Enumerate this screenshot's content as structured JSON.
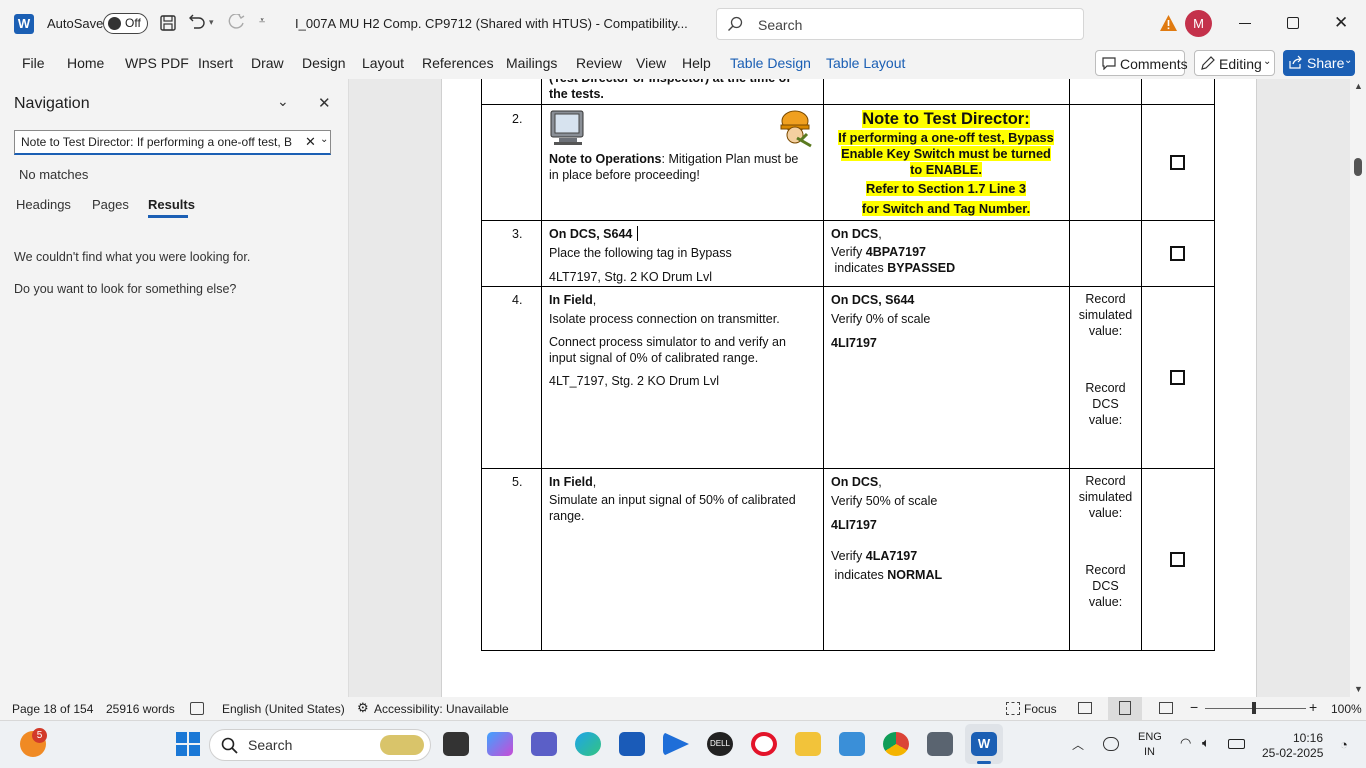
{
  "titlebar": {
    "autosave_label": "AutoSave",
    "autosave_state": "Off",
    "doc_title": "I_007A MU H2 Comp. CP9712 (Shared with HTUS)  -  Compatibility...",
    "search_placeholder": "Search",
    "avatar_initial": "M"
  },
  "ribbon": {
    "tabs": [
      "File",
      "Home",
      "WPS PDF",
      "Insert",
      "Draw",
      "Design",
      "Layout",
      "References",
      "Mailings",
      "Review",
      "View",
      "Help",
      "Table Design",
      "Table Layout"
    ],
    "comments_label": "Comments",
    "editing_label": "Editing",
    "share_label": "Share"
  },
  "navigation": {
    "title": "Navigation",
    "search_value": "Note to Test Director: If performing a one-off test, B",
    "no_matches": "No matches",
    "tabs": [
      "Headings",
      "Pages",
      "Results"
    ],
    "active_tab": "Results",
    "message1": "We couldn't find what you were looking for.",
    "message2": "Do you want to look for something else?"
  },
  "document": {
    "top_fragment_line1": "(Test Director or Inspector) at the time of",
    "top_fragment_line2": "the tests.",
    "row2": {
      "num": "2.",
      "note_label": "Note to Operations",
      "note_text1": ": Mitigation Plan must be",
      "note_text2": "in place before proceeding!",
      "td_title": "Note to Test Director:",
      "td_line1": "If performing a one-off test, Bypass",
      "td_line2": "Enable Key Switch must be turned",
      "td_line3": "to ENABLE.",
      "td_line4": "Refer to Section 1.7 Line 3",
      "td_line5": "for Switch and Tag Number."
    },
    "row3": {
      "num": "3.",
      "action_line1": "On DCS, S644",
      "action_line2": "Place the following tag in Bypass",
      "action_line3": "4LT7197, Stg. 2 KO Drum Lvl",
      "verify_line1": "On DCS",
      "verify_comma": ",",
      "verify_prefix": "Verify ",
      "verify_tag": "4BPA7197",
      "indicates_prefix": " indicates ",
      "indicates_value": "BYPASSED"
    },
    "row4": {
      "num": "4.",
      "field_label": "In Field",
      "field_comma": ",",
      "action_line2": "Isolate process connection on transmitter.",
      "action_line3": "Connect process simulator to and verify an",
      "action_line4": "input signal of 0% of calibrated range.",
      "action_line5": "4LT_7197, Stg. 2 KO Drum Lvl",
      "verify_line1": "On DCS, S644",
      "verify_line2": "Verify 0% of scale",
      "verify_line3": "4LI7197",
      "record1": [
        "Record",
        "simulated",
        "value:"
      ],
      "record2": [
        "Record",
        "DCS",
        "value:"
      ]
    },
    "row5": {
      "num": "5.",
      "field_label": "In Field",
      "field_comma": ",",
      "action_line2": "Simulate an input signal of 50% of calibrated",
      "action_line3": "range.",
      "verify_line1": "On DCS",
      "verify_comma": ",",
      "verify_line2": "Verify 50% of scale",
      "verify_line3": "4LI7197",
      "verify_prefix": "Verify ",
      "verify_tag": "4LA7197",
      "indicates_prefix": " indicates ",
      "indicates_value": "NORMAL",
      "record1": [
        "Record",
        "simulated",
        "value:"
      ],
      "record2": [
        "Record",
        "DCS",
        "value:"
      ]
    }
  },
  "statusbar": {
    "page": "Page 18 of 154",
    "words": "25916 words",
    "language": "English (United States)",
    "accessibility": "Accessibility: Unavailable",
    "focus": "Focus",
    "zoom": "100%"
  },
  "taskbar": {
    "badge_count": "5",
    "search_label": "Search",
    "lang_line1": "ENG",
    "lang_line2": "IN",
    "time": "10:16",
    "date": "25-02-2025"
  },
  "colors": {
    "accent": "#1b5fb4",
    "highlight": "#ffff00",
    "avatar": "#c4314b",
    "warning": "#e07a10"
  }
}
